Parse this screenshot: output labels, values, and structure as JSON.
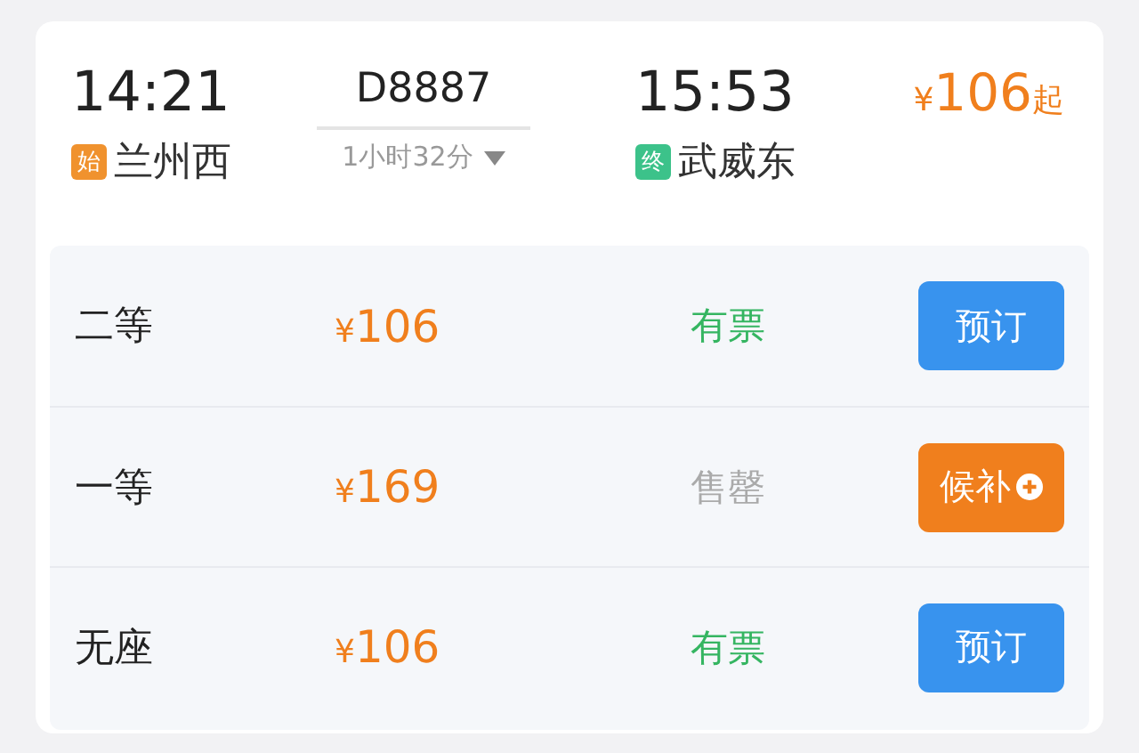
{
  "train": {
    "departure": {
      "time": "14:21",
      "badge": {
        "label": "始",
        "color": "#f0922e"
      },
      "station": "兰州西"
    },
    "number": "D8887",
    "duration": "1小时32分",
    "expanded": false,
    "arrival": {
      "time": "15:53",
      "badge": {
        "label": "终",
        "color": "#3cc28a"
      },
      "station": "武威东"
    },
    "price": {
      "currency": "¥",
      "amount": "106",
      "suffix": "起"
    }
  },
  "seats": [
    {
      "class": "二等",
      "currency": "¥",
      "amount": "106",
      "status": "有票",
      "available": true,
      "button": {
        "kind": "book",
        "label": "预订"
      }
    },
    {
      "class": "一等",
      "currency": "¥",
      "amount": "169",
      "status": "售罄",
      "available": false,
      "button": {
        "kind": "waitlist",
        "label": "候补"
      }
    },
    {
      "class": "无座",
      "currency": "¥",
      "amount": "106",
      "status": "有票",
      "available": true,
      "button": {
        "kind": "book",
        "label": "预订"
      }
    }
  ]
}
